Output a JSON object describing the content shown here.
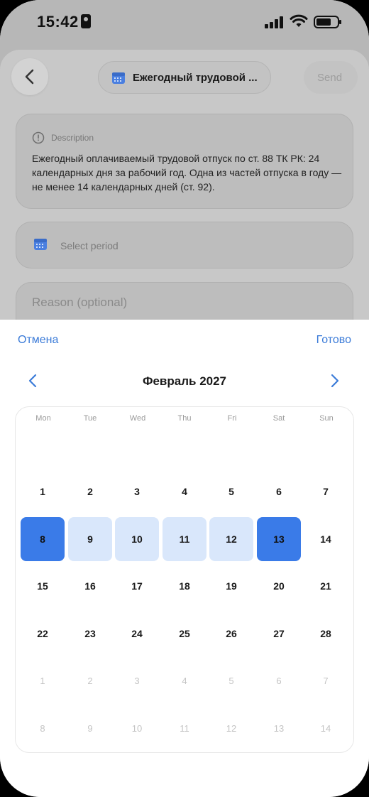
{
  "status": {
    "time": "15:42"
  },
  "header": {
    "title": "Ежегодный трудовой ...",
    "send_label": "Send"
  },
  "description": {
    "label": "Description",
    "text": "Ежегодный оплачиваемый трудовой отпуск по ст. 88 ТК РК: 24 календарных дня за рабочий год. Одна из частей отпуска в году — не менее 14 календарных дней (ст. 92)."
  },
  "period": {
    "placeholder": "Select period"
  },
  "reason": {
    "placeholder": "Reason (optional)"
  },
  "picker": {
    "cancel_label": "Отмена",
    "done_label": "Готово",
    "month_label": "Февраль 2027",
    "weekdays": [
      "Mon",
      "Tue",
      "Wed",
      "Thu",
      "Fri",
      "Sat",
      "Sun"
    ],
    "weeks": [
      [],
      [
        "1",
        "2",
        "3",
        "4",
        "5",
        "6",
        "7"
      ],
      [
        "8",
        "9",
        "10",
        "11",
        "12",
        "13",
        "14"
      ],
      [
        "15",
        "16",
        "17",
        "18",
        "19",
        "20",
        "21"
      ],
      [
        "22",
        "23",
        "24",
        "25",
        "26",
        "27",
        "28"
      ],
      [
        "1",
        "2",
        "3",
        "4",
        "5",
        "6",
        "7"
      ],
      [
        "8",
        "9",
        "10",
        "11",
        "12",
        "13",
        "14"
      ]
    ],
    "range_start": "8",
    "range_end": "13",
    "colors": {
      "accent": "#3a7be8",
      "range": "#d9e7fb",
      "link": "#3b7bd8"
    }
  }
}
